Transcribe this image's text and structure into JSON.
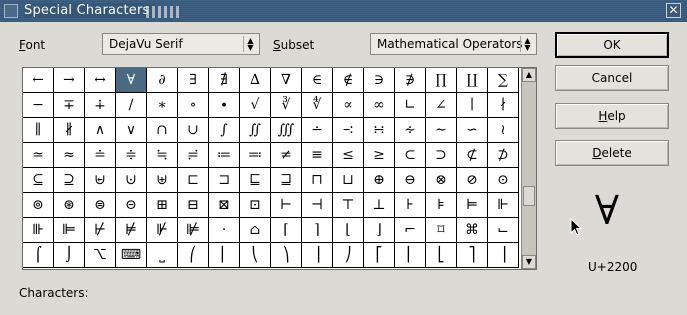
{
  "window": {
    "title": "Special Characters",
    "close_glyph": "✕"
  },
  "font": {
    "label_ul": "F",
    "label_rest": "ont",
    "value": "DejaVu Serif"
  },
  "subset": {
    "label_ul": "S",
    "label_rest": "ubset",
    "value": "Mathematical Operators"
  },
  "grid": {
    "selected_index": 3,
    "cells": [
      "←",
      "→",
      "↔",
      "∀",
      "∂",
      "∃",
      "∄",
      "∆",
      "∇",
      "∈",
      "∉",
      "∋",
      "∌",
      "∏",
      "∐",
      "∑",
      "−",
      "∓",
      "∔",
      "∕",
      "∗",
      "∘",
      "∙",
      "√",
      "∛",
      "∜",
      "∝",
      "∞",
      "∟",
      "∠",
      "∣",
      "∤",
      "∥",
      "∦",
      "∧",
      "∨",
      "∩",
      "∪",
      "∫",
      "∬",
      "∭",
      "∸",
      "∹",
      "∺",
      "∻",
      "∼",
      "∽",
      "≀",
      "≃",
      "≈",
      "≐",
      "≑",
      "≒",
      "≓",
      "≔",
      "≕",
      "≠",
      "≡",
      "≤",
      "≥",
      "⊂",
      "⊃",
      "⊄",
      "⊅",
      "⊆",
      "⊇",
      "⊌",
      "⊍",
      "⊎",
      "⊏",
      "⊐",
      "⊑",
      "⊒",
      "⊓",
      "⊔",
      "⊕",
      "⊖",
      "⊗",
      "⊘",
      "⊙",
      "⊚",
      "⊛",
      "⊜",
      "⊝",
      "⊞",
      "⊟",
      "⊠",
      "⊡",
      "⊢",
      "⊣",
      "⊤",
      "⊥",
      "⊦",
      "⊧",
      "⊨",
      "⊩",
      "⊪",
      "⊫",
      "⊬",
      "⊭",
      "⊮",
      "⊯",
      "⋅",
      "⌂",
      "⌈",
      "⌉",
      "⌊",
      "⌋",
      "⌐",
      "⌑",
      "⌘",
      "⌙",
      "⌠",
      "⌡",
      "⌥",
      "⌨",
      "⎵",
      "⎛",
      "⎜",
      "⎝",
      "⎞",
      "⎟",
      "⎠",
      "⎡",
      "⎢",
      "⎣",
      "⎤",
      "⎥"
    ]
  },
  "buttons": {
    "ok": "OK",
    "cancel": "Cancel",
    "help_ul": "H",
    "help_rest": "elp",
    "delete_ul": "D",
    "delete_rest": "elete"
  },
  "preview": {
    "glyph": "∀",
    "codepoint": "U+2200"
  },
  "characters": {
    "label": "Characters:"
  },
  "scrollbar": {
    "up": "▲",
    "down": "▼"
  }
}
